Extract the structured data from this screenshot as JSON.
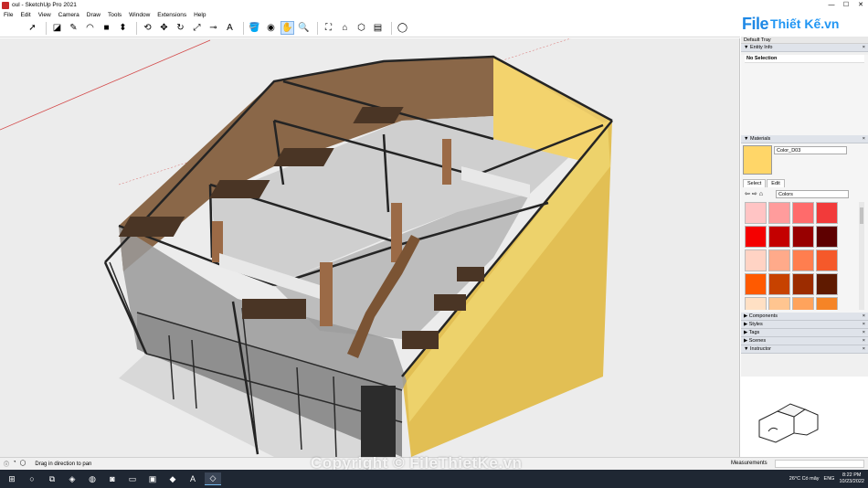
{
  "window": {
    "title": "oul - SketchUp Pro 2021",
    "controls": [
      "—",
      "☐",
      "✕"
    ]
  },
  "menu": [
    "File",
    "Edit",
    "View",
    "Camera",
    "Draw",
    "Tools",
    "Window",
    "Extensions",
    "Help"
  ],
  "brand": {
    "word1": "File",
    "word2": "Thiết Kế.vn"
  },
  "toolbar": {
    "tools": [
      {
        "name": "select-icon",
        "glyph": "➚"
      },
      {
        "name": "eraser-icon",
        "glyph": "◪"
      },
      {
        "name": "pencil-icon",
        "glyph": "✎"
      },
      {
        "name": "arc-icon",
        "glyph": "◠"
      },
      {
        "name": "shapes-icon",
        "glyph": "■"
      },
      {
        "name": "push-pull-icon",
        "glyph": "⬍"
      },
      {
        "name": "offset-icon",
        "glyph": "⟲"
      },
      {
        "name": "move-icon",
        "glyph": "✥"
      },
      {
        "name": "rotate-icon",
        "glyph": "↻"
      },
      {
        "name": "scale-icon",
        "glyph": "⤢"
      },
      {
        "name": "tape-measure-icon",
        "glyph": "⊸"
      },
      {
        "name": "text-icon",
        "glyph": "A"
      },
      {
        "name": "paint-bucket-icon",
        "glyph": "🪣"
      },
      {
        "name": "orbit-icon",
        "glyph": "◉"
      },
      {
        "name": "pan-icon",
        "glyph": "✋"
      },
      {
        "name": "zoom-icon",
        "glyph": "🔍"
      },
      {
        "name": "zoom-extents-icon",
        "glyph": "⛶"
      },
      {
        "name": "warehouse-icon",
        "glyph": "⌂"
      },
      {
        "name": "extension-warehouse-icon",
        "glyph": "⬡"
      },
      {
        "name": "layout-icon",
        "glyph": "▤"
      },
      {
        "name": "account-icon",
        "glyph": "◯"
      }
    ]
  },
  "tray": {
    "title": "Default Tray",
    "entity_info": {
      "header": "Entity Info",
      "selection": "No Selection"
    },
    "materials": {
      "header": "Materials",
      "current_name": "Color_D03",
      "current_color": "#ffd668",
      "tabs": [
        "Select",
        "Edit"
      ],
      "collection": "Colors",
      "swatches": [
        "#ffc4c4",
        "#ff9c9c",
        "#ff6b6b",
        "#f23a3a",
        "#f50000",
        "#c40000",
        "#980000",
        "#5e0000",
        "#ffd3c4",
        "#ffaa8a",
        "#ff7e4f",
        "#f5592a",
        "#ff5a00",
        "#c74200",
        "#9c2c00",
        "#5f1a00",
        "#ffe0c4",
        "#ffc590",
        "#ffa35c",
        "#f58426",
        "#ff9500",
        "#d97a00",
        "#b35e00",
        "#6b3800"
      ]
    },
    "collapsed_sections": [
      "Components",
      "Styles",
      "Tags",
      "Scenes"
    ],
    "instructor": {
      "header": "Instructor"
    }
  },
  "status": {
    "hint": "Drag in direction to pan",
    "measurements_label": "Measurements"
  },
  "watermark": "Copyright © FileThietKe.vn",
  "taskbar": {
    "apps": [
      {
        "name": "windows-start-icon",
        "glyph": "⊞"
      },
      {
        "name": "search-taskbar-icon",
        "glyph": "○"
      },
      {
        "name": "task-view-icon",
        "glyph": "⧉"
      },
      {
        "name": "messenger-icon",
        "glyph": "◈"
      },
      {
        "name": "chrome-icon",
        "glyph": "◍"
      },
      {
        "name": "zalo-icon",
        "glyph": "◙"
      },
      {
        "name": "file-explorer-icon",
        "glyph": "▭"
      },
      {
        "name": "photos-icon",
        "glyph": "▣"
      },
      {
        "name": "remote-icon",
        "glyph": "◆"
      },
      {
        "name": "autocad-icon",
        "glyph": "A"
      },
      {
        "name": "sketchup-icon",
        "glyph": "◇"
      }
    ],
    "weather": "26°C  Có mây",
    "lang": "ENG",
    "time": "8:22 PM",
    "date": "10/23/2022"
  }
}
